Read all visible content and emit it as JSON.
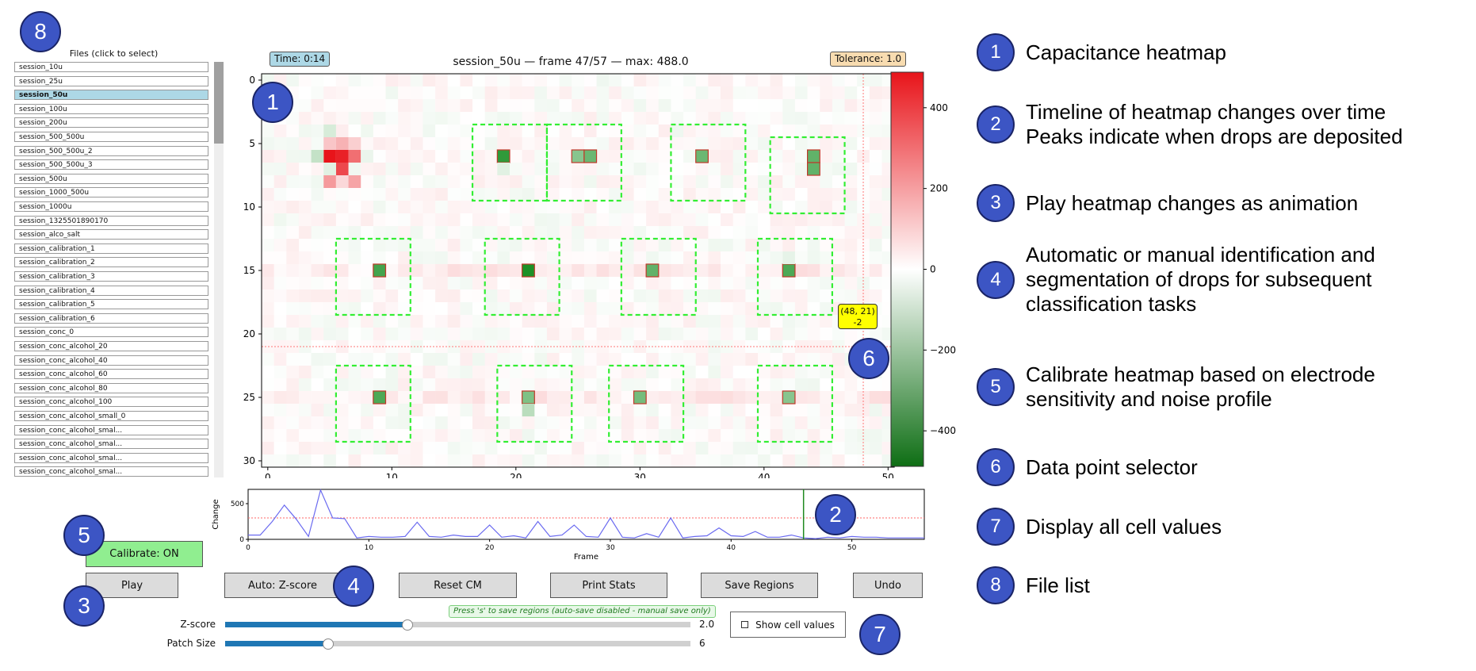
{
  "files": {
    "title": "Files (click to select)",
    "items": [
      "session_10u",
      "session_25u",
      "session_50u",
      "session_100u",
      "session_200u",
      "session_500_500u",
      "session_500_500u_2",
      "session_500_500u_3",
      "session_500u",
      "session_1000_500u",
      "session_1000u",
      "session_1325501890170",
      "session_alco_salt",
      "session_calibration_1",
      "session_calibration_2",
      "session_calibration_3",
      "session_calibration_4",
      "session_calibration_5",
      "session_calibration_6",
      "session_conc_0",
      "session_conc_alcohol_20",
      "session_conc_alcohol_40",
      "session_conc_alcohol_60",
      "session_conc_alcohol_80",
      "session_conc_alcohol_100",
      "session_conc_alcohol_small_0",
      "session_conc_alcohol_smal...",
      "session_conc_alcohol_smal...",
      "session_conc_alcohol_smal...",
      "session_conc_alcohol_smal..."
    ],
    "selected_index": 2
  },
  "heatmap": {
    "title": "session_50u — frame 47/57 — max: 488.0",
    "time_label": "Time: 0:14",
    "tolerance_label": "Tolerance: 1.0",
    "tooltip_line1": "(48, 21)",
    "tooltip_line2": "-2",
    "x_ticks": [
      "0",
      "10",
      "20",
      "30",
      "40",
      "50"
    ],
    "y_ticks": [
      "0",
      "5",
      "10",
      "15",
      "20",
      "25",
      "30"
    ],
    "colorbar_ticks": [
      "400",
      "200",
      "0",
      "−200",
      "−400"
    ],
    "colors": {
      "positive": "#e8141a",
      "negative": "#0e8a1a",
      "region": "#33ee33",
      "crosshair": "#ff7777",
      "tooltip": "#ffff00"
    }
  },
  "chart_data": [
    {
      "type": "heatmap",
      "x_range": [
        0,
        51
      ],
      "y_range": [
        0,
        31
      ],
      "color_range": [
        -488,
        488
      ],
      "selected_cell": [
        48,
        21
      ],
      "regions": [
        [
          17,
          4,
          6,
          6
        ],
        [
          23,
          4,
          6,
          6
        ],
        [
          33,
          4,
          6,
          6
        ],
        [
          41,
          5,
          6,
          6
        ],
        [
          6,
          13,
          6,
          6
        ],
        [
          18,
          13,
          6,
          6
        ],
        [
          29,
          13,
          6,
          6
        ],
        [
          40,
          13,
          6,
          6
        ],
        [
          6,
          23,
          6,
          6
        ],
        [
          19,
          23,
          6,
          6
        ],
        [
          28,
          23,
          6,
          6
        ],
        [
          40,
          23,
          6,
          6
        ]
      ],
      "cells": [
        [
          5,
          6,
          488
        ],
        [
          6,
          6,
          460
        ],
        [
          6,
          7,
          380
        ],
        [
          7,
          6,
          300
        ],
        [
          5,
          5,
          120
        ],
        [
          6,
          5,
          160
        ],
        [
          4,
          6,
          -120
        ],
        [
          7,
          5,
          100
        ],
        [
          5,
          7,
          -60
        ],
        [
          5,
          8,
          210
        ],
        [
          7,
          8,
          190
        ],
        [
          6,
          8,
          80
        ],
        [
          8,
          6,
          -40
        ],
        [
          5,
          4,
          -80
        ],
        [
          19,
          6,
          -420
        ],
        [
          19,
          7,
          -60
        ],
        [
          25,
          6,
          -240
        ],
        [
          26,
          6,
          -300
        ],
        [
          35,
          6,
          -300
        ],
        [
          44,
          6,
          -320
        ],
        [
          44,
          7,
          -320
        ],
        [
          9,
          15,
          -380
        ],
        [
          21,
          15,
          -460
        ],
        [
          31,
          15,
          -320
        ],
        [
          42,
          15,
          -360
        ],
        [
          42,
          14,
          -50
        ],
        [
          9,
          25,
          -360
        ],
        [
          21,
          25,
          -260
        ],
        [
          21,
          26,
          -140
        ],
        [
          30,
          25,
          -280
        ],
        [
          42,
          25,
          -240
        ]
      ]
    },
    {
      "type": "line",
      "xlabel": "Frame",
      "ylabel": "Change",
      "xlim": [
        0,
        56
      ],
      "ylim": [
        0,
        700
      ],
      "x_ticks": [
        "0",
        "10",
        "20",
        "30",
        "40",
        "50"
      ],
      "y_ticks": [
        "0",
        "500"
      ],
      "threshold": 300,
      "current_frame": 46,
      "y": [
        60,
        60,
        250,
        480,
        280,
        40,
        690,
        300,
        290,
        20,
        40,
        30,
        30,
        40,
        240,
        40,
        30,
        60,
        40,
        40,
        200,
        30,
        50,
        20,
        250,
        40,
        60,
        200,
        40,
        30,
        300,
        30,
        20,
        80,
        30,
        300,
        20,
        40,
        50,
        160,
        50,
        40,
        110,
        30,
        30,
        60,
        20,
        10,
        30,
        20,
        40,
        30,
        30,
        20,
        20,
        20,
        20
      ]
    }
  ],
  "buttons": {
    "calibrate": "Calibrate: ON",
    "play": "Play",
    "auto": "Auto: Z-score",
    "reset": "Reset CM",
    "print": "Print Stats",
    "save": "Save Regions",
    "undo": "Undo"
  },
  "sliders": {
    "zscore": {
      "label": "Z-score",
      "value": "2.0",
      "fraction": 0.39
    },
    "patch": {
      "label": "Patch Size",
      "value": "6",
      "fraction": 0.22
    }
  },
  "save_hint": "Press 's' to save regions (auto-save disabled - manual save only)",
  "show_cells_label": "Show cell values",
  "badges": [
    "1",
    "2",
    "3",
    "4",
    "5",
    "6",
    "7",
    "8"
  ],
  "legend": [
    {
      "num": "1",
      "text": "Capacitance heatmap"
    },
    {
      "num": "2",
      "text": "Timeline of heatmap changes over time\nPeaks indicate when drops are deposited"
    },
    {
      "num": "3",
      "text": "Play heatmap changes as animation"
    },
    {
      "num": "4",
      "text": "Automatic or manual identification and\nsegmentation of drops for subsequent\nclassification tasks"
    },
    {
      "num": "5",
      "text": "Calibrate heatmap based on electrode\nsensitivity and noise profile"
    },
    {
      "num": "6",
      "text": "Data point selector"
    },
    {
      "num": "7",
      "text": "Display all cell values"
    },
    {
      "num": "8",
      "text": "File list"
    }
  ]
}
